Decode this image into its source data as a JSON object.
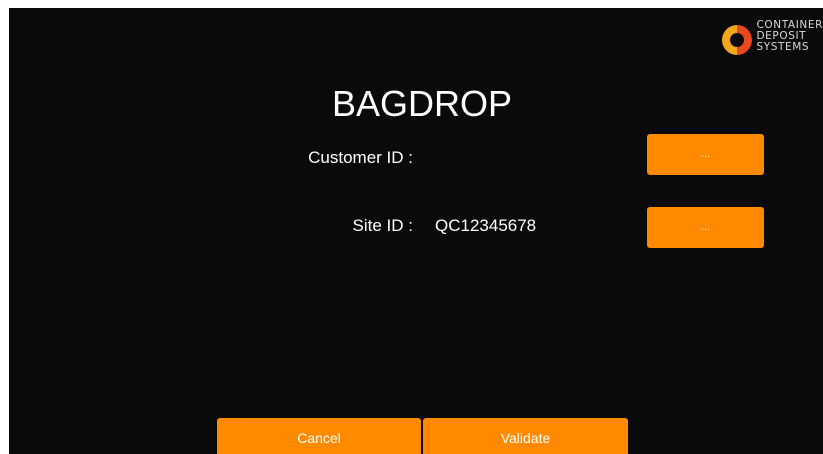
{
  "app": {
    "title": "BAGDROP"
  },
  "logo": {
    "line1": "CONTAINER",
    "line2": "DEPOSIT",
    "line3": "SYSTEMS",
    "icon": "container-deposit-systems-logo-icon"
  },
  "fields": {
    "customer_id": {
      "label": "Customer ID :",
      "value": "",
      "button_label": "..."
    },
    "site_id": {
      "label": "Site ID :",
      "value": "QC12345678",
      "button_label": "..."
    }
  },
  "actions": {
    "cancel_label": "Cancel",
    "validate_label": "Validate"
  },
  "colors": {
    "background": "#0a0a0a",
    "accent": "#ff8a00",
    "text": "#ffffff"
  }
}
